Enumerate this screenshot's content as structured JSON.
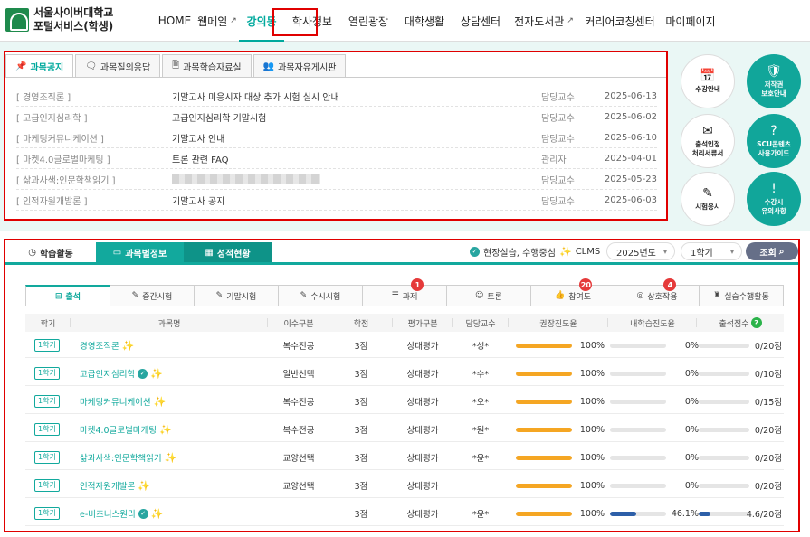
{
  "header": {
    "logo_line1": "서울사이버대학교",
    "logo_line2": "포털서비스(학생)",
    "nav": [
      {
        "label": "HOME",
        "ext": false
      },
      {
        "label": "웹메일",
        "ext": true
      },
      {
        "label": "강의동",
        "ext": false,
        "active": true
      },
      {
        "label": "학사정보",
        "ext": false
      },
      {
        "label": "열린광장",
        "ext": false
      },
      {
        "label": "대학생활",
        "ext": false
      },
      {
        "label": "상담센터",
        "ext": false
      },
      {
        "label": "전자도서관",
        "ext": true
      },
      {
        "label": "커리어코칭센터",
        "ext": false
      },
      {
        "label": "마이페이지",
        "ext": false
      }
    ],
    "external_icon": "↗"
  },
  "notice": {
    "tabs": [
      {
        "label": "과목공지",
        "icon": "pin-icon",
        "glyph": "📌"
      },
      {
        "label": "과목질의응답",
        "icon": "chat-icon",
        "glyph": "🗨"
      },
      {
        "label": "과목학습자료실",
        "icon": "document-icon",
        "glyph": "🗎"
      },
      {
        "label": "과목자유게시판",
        "icon": "people-icon",
        "glyph": "👥"
      }
    ],
    "rows": [
      {
        "course": "[ 경영조직론 ]",
        "title": "기말고사 미응시자 대상 추가 시험 실시 안내",
        "role": "담당교수",
        "date": "2025-06-13"
      },
      {
        "course": "[ 고급인지심리학 ]",
        "title": "고급인지심리학 기말시험",
        "role": "담당교수",
        "date": "2025-06-02"
      },
      {
        "course": "[ 마케팅커뮤니케이션 ]",
        "title": "기말고사 안내",
        "role": "담당교수",
        "date": "2025-06-10"
      },
      {
        "course": "[ 마켓4.0글로벌마케팅 ]",
        "title": "토론 관련 FAQ",
        "role": "관리자",
        "date": "2025-04-01"
      },
      {
        "course": "[ 삶과사색:인문학책읽기 ]",
        "title": "",
        "role": "담당교수",
        "date": "2025-05-23",
        "blurred": true
      },
      {
        "course": "[ 인적자원개발론 ]",
        "title": "기말고사 공지",
        "role": "담당교수",
        "date": "2025-06-03"
      }
    ]
  },
  "quick": [
    {
      "label1": "수강안내",
      "label2": "",
      "style": "w",
      "icon": "calendar-icon",
      "glyph": "📅"
    },
    {
      "label1": "저작권",
      "label2": "보호안내",
      "style": "g",
      "icon": "copyright-icon",
      "glyph": "🛡"
    },
    {
      "label1": "출석인정",
      "label2": "처리서류서",
      "style": "w",
      "icon": "mail-icon",
      "glyph": "✉"
    },
    {
      "label1": "SCU콘텐츠",
      "label2": "사용가이드",
      "style": "g",
      "icon": "help-icon",
      "glyph": "?"
    },
    {
      "label1": "시험응시",
      "label2": "",
      "style": "w",
      "icon": "pen-icon",
      "glyph": "✎"
    },
    {
      "label1": "수강시",
      "label2": "유의사항",
      "style": "g",
      "icon": "warning-icon",
      "glyph": "!"
    }
  ],
  "study": {
    "tabs": [
      {
        "label": "학습활동",
        "icon": "clock-icon",
        "glyph": "◷",
        "style": "plain"
      },
      {
        "label": "과목별정보",
        "icon": "monitor-icon",
        "glyph": "▭",
        "style": "teal"
      },
      {
        "label": "성적현황",
        "icon": "grid-icon",
        "glyph": "▦",
        "style": "teal2"
      }
    ],
    "filter_label": "현장실습, 수행중심",
    "clms_label": "CLMS",
    "year": "2025년도",
    "term": "1학기",
    "search_label": "조회",
    "subtabs": [
      {
        "label": "출석",
        "icon": "attendance-icon",
        "glyph": "⊟",
        "badge": ""
      },
      {
        "label": "중간시험",
        "icon": "test-icon",
        "glyph": "✎",
        "badge": ""
      },
      {
        "label": "기말시험",
        "icon": "test-icon",
        "glyph": "✎",
        "badge": ""
      },
      {
        "label": "수시시험",
        "icon": "test-icon",
        "glyph": "✎",
        "badge": ""
      },
      {
        "label": "과제",
        "icon": "task-icon",
        "glyph": "☰",
        "badge": "1"
      },
      {
        "label": "토론",
        "icon": "discussion-icon",
        "glyph": "☺",
        "badge": ""
      },
      {
        "label": "참여도",
        "icon": "thumb-icon",
        "glyph": "👍",
        "badge": "20"
      },
      {
        "label": "상호작용",
        "icon": "interaction-icon",
        "glyph": "◎",
        "badge": "4"
      },
      {
        "label": "실습수행활동",
        "icon": "practice-icon",
        "glyph": "♜",
        "badge": ""
      }
    ],
    "columns": [
      "학기",
      "과목명",
      "이수구분",
      "학점",
      "평가구분",
      "담당교수",
      "권장진도율",
      "내학습진도율",
      "출석점수"
    ],
    "rows": [
      {
        "sem": "1학기",
        "name": "경영조직론",
        "check": false,
        "type": "복수전공",
        "credit": "3점",
        "eval": "상대평가",
        "prof": "*성*",
        "rec": "100%",
        "rec_v": 1.0,
        "mine": "0%",
        "mine_v": 0,
        "score": "0/20점",
        "score_v": 0
      },
      {
        "sem": "1학기",
        "name": "고급인지심리학",
        "check": true,
        "type": "일반선택",
        "credit": "3점",
        "eval": "상대평가",
        "prof": "*수*",
        "rec": "100%",
        "rec_v": 1.0,
        "mine": "0%",
        "mine_v": 0,
        "score": "0/10점",
        "score_v": 0
      },
      {
        "sem": "1학기",
        "name": "마케팅커뮤니케이션",
        "check": false,
        "type": "복수전공",
        "credit": "3점",
        "eval": "상대평가",
        "prof": "*오*",
        "rec": "100%",
        "rec_v": 1.0,
        "mine": "0%",
        "mine_v": 0,
        "score": "0/15점",
        "score_v": 0
      },
      {
        "sem": "1학기",
        "name": "마켓4.0글로벌마케팅",
        "check": false,
        "type": "복수전공",
        "credit": "3점",
        "eval": "상대평가",
        "prof": "*원*",
        "rec": "100%",
        "rec_v": 1.0,
        "mine": "0%",
        "mine_v": 0,
        "score": "0/20점",
        "score_v": 0
      },
      {
        "sem": "1학기",
        "name": "삶과사색:인문학책읽기",
        "check": false,
        "type": "교양선택",
        "credit": "3점",
        "eval": "상대평가",
        "prof": "*윤*",
        "rec": "100%",
        "rec_v": 1.0,
        "mine": "0%",
        "mine_v": 0,
        "score": "0/20점",
        "score_v": 0
      },
      {
        "sem": "1학기",
        "name": "인적자원개발론",
        "check": false,
        "type": "교양선택",
        "credit": "3점",
        "eval": "상대평가",
        "prof": "",
        "rec": "100%",
        "rec_v": 1.0,
        "mine": "0%",
        "mine_v": 0,
        "score": "0/20점",
        "score_v": 0
      },
      {
        "sem": "1학기",
        "name": "e-비즈니스원리",
        "check": true,
        "type": "",
        "credit": "3점",
        "eval": "상대평가",
        "prof": "*윤*",
        "rec": "100%",
        "rec_v": 1.0,
        "mine": "46.1%",
        "mine_v": 0.461,
        "score": "4.6/20점",
        "score_v": 0.23
      }
    ],
    "qmark": "?",
    "check_glyph": "✓",
    "spark_glyph": "✨"
  },
  "colors": {
    "accent": "#12a99d",
    "highlight": "#e00000",
    "progress_recommended": "#f5a623",
    "progress_mine": "#2d5fa8"
  }
}
